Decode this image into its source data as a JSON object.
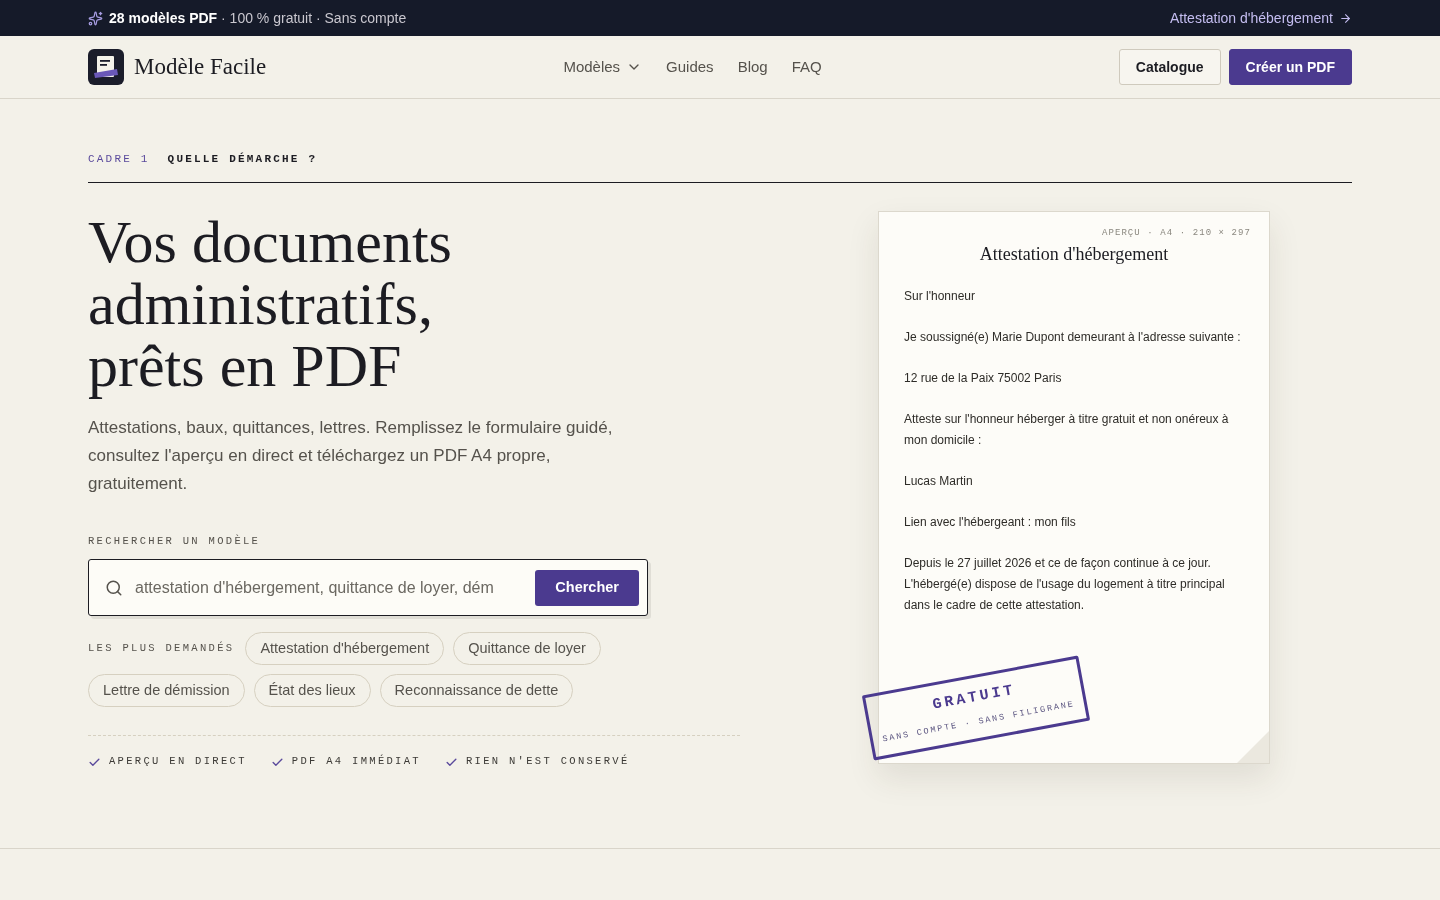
{
  "announcement": {
    "text": "**28 modèles PDF** · 100 % gratuit · Sans compte",
    "link": "Attestation d'hébergement"
  },
  "header": {
    "brand": "Modèle Facile",
    "nav": [
      {
        "label": "Modèles",
        "kind": "dropdown"
      },
      {
        "label": "Guides",
        "kind": "link"
      },
      {
        "label": "Blog",
        "kind": "link"
      },
      {
        "label": "FAQ",
        "kind": "link"
      }
    ],
    "actions": [
      {
        "label": "Catalogue",
        "kind": "secondary"
      },
      {
        "label": "Créer un PDF",
        "kind": "primary"
      }
    ]
  },
  "section": {
    "index": "CADRE 1",
    "title": "QUELLE DÉMARCHE ?"
  },
  "hero": {
    "title_lines": [
      "Vos documents",
      "administratifs,",
      "prêts en PDF"
    ],
    "lead": "Attestations, baux, quittances, lettres. Remplissez le formulaire guidé, consultez l'aperçu en direct et téléchargez un PDF A4 propre, gratuitement.",
    "search": {
      "label": "RECHERCHER UN MODÈLE",
      "placeholder": "attestation d'hébergement, quittance de loyer, dém",
      "button": "Chercher"
    },
    "popular": {
      "label": "LES PLUS DEMANDÉS",
      "items": [
        "Attestation d'hébergement",
        "Quittance de loyer",
        "Lettre de démission",
        "État des lieux",
        "Reconnaissance de dette"
      ]
    },
    "features": [
      "APERÇU EN DIRECT",
      "PDF A4 IMMÉDIAT",
      "RIEN N'EST CONSERVÉ"
    ]
  },
  "preview": {
    "meta": "APERÇU · A4 · 210 × 297",
    "title": "Attestation d'hébergement",
    "paragraphs": [
      "Sur l'honneur",
      "Je soussigné(e) Marie Dupont demeurant à l'adresse suivante :",
      "12 rue de la Paix 75002 Paris",
      "Atteste sur l'honneur héberger à titre gratuit et non onéreux à mon domicile :",
      "Lucas Martin",
      "Lien avec l'hébergeant : mon fils",
      "Depuis le 27 juillet 2026 et ce de façon continue à ce jour. L'hébergé(e) dispose de l'usage du logement à titre principal dans le cadre de cette attestation."
    ],
    "stamp": {
      "title": "GRATUIT",
      "subtitle": "SANS COMPTE · SANS FILIGRANE"
    }
  }
}
